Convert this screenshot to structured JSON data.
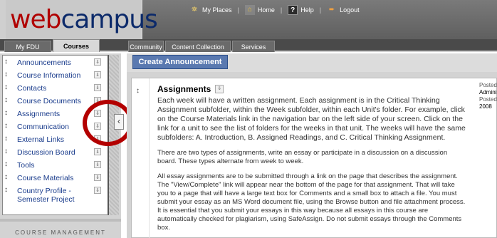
{
  "header": {
    "logo_web": "web",
    "logo_campus": "campus",
    "links": [
      {
        "label": "My Places",
        "icon": "places-icon"
      },
      {
        "label": "Home",
        "icon": "home-icon"
      },
      {
        "label": "Help",
        "icon": "help-icon"
      },
      {
        "label": "Logout",
        "icon": "logout-icon"
      }
    ]
  },
  "tabs": [
    {
      "label": "My FDU"
    },
    {
      "label": "Courses",
      "active": true
    },
    {
      "label": "Community"
    },
    {
      "label": "Content Collection"
    },
    {
      "label": "Services"
    }
  ],
  "sidebar": {
    "items": [
      {
        "label": "Announcements"
      },
      {
        "label": "Course Information"
      },
      {
        "label": "Contacts"
      },
      {
        "label": "Course Documents"
      },
      {
        "label": "Assignments"
      },
      {
        "label": "Communication"
      },
      {
        "label": "External Links"
      },
      {
        "label": "Discussion Board"
      },
      {
        "label": "Tools"
      },
      {
        "label": "Course Materials"
      },
      {
        "label_line1": "Country Profile -",
        "label_line2": "Semester Project"
      }
    ],
    "footer": "COURSE MANAGEMENT"
  },
  "main": {
    "create_button": "Create Announcement",
    "item": {
      "title": "Assignments",
      "paragraphs": [
        "Each week will have a written assignment. Each assignment is in the Critical Thinking Assignment subfolder, within the Week subfolder, within each Unit's folder. For example, click on the Course Materials link in the navigation bar on the left side of your screen. Click on the link for a unit to see the list of folders for the weeks in that unit. The weeks will have the same subfolders: A. Introduction, B. Assigned Readings, and C. Critical Thinking Assignment.",
        "There are two types of assignments, write an essay or participate in a discussion on a discussion board. These types alternate from week to week.",
        "All essay assignments are to be submitted through a link on the page that describes the assignment. The \"View/Complete\" link will appear near the bottom of the page for that assignment. That will take you to a page that will have a large text box for Comments and a small box to attach a file. You must submit your essay as an MS Word document file, using the Browse button and file attachment process. It is essential that you submit your essays in this way because all essays in this course are automatically checked for plagiarism, using SafeAssign. Do not submit essays through the Comments box."
      ],
      "meta_posted_label": "Posted",
      "meta_author": "Adminis",
      "meta_posted_label2": "Posted",
      "meta_year": "2008"
    }
  },
  "colors": {
    "header_grey": "#6a6a6a",
    "logo_red": "#b00000",
    "logo_navy": "#0c2a6a",
    "nav_link": "#1a3c8c",
    "button_blue": "#5a79b0",
    "annotation_red": "#b30000"
  }
}
